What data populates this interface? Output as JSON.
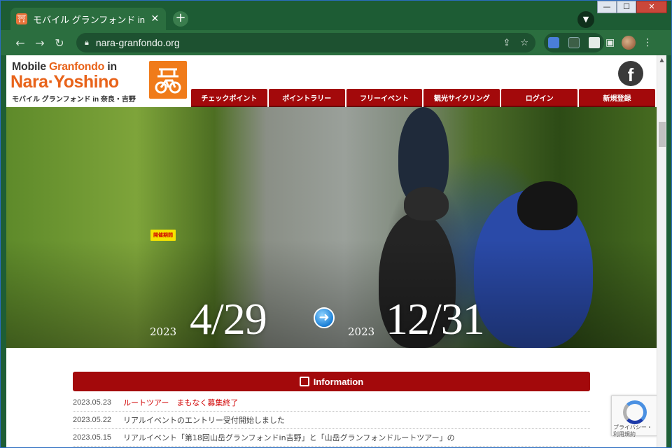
{
  "browser": {
    "tab_title": "モバイル グランフォンド in 奈良",
    "tab_close": "✕",
    "new_tab": "+",
    "url": "nara-granfondo.org"
  },
  "site": {
    "logo": {
      "line1_a": "Mobile ",
      "line1_b": "Granfondo",
      "line1_c": " in",
      "line2": "Nara·Yoshino",
      "line3": "モバイル グランフォンド in 奈良・吉野"
    },
    "facebook_glyph": "f",
    "nav": [
      "チェックポイント",
      "ポイントラリー",
      "フリーイベント",
      "観光サイクリング",
      "ログイン",
      "新規登録"
    ]
  },
  "hero": {
    "period_badge": "開催期間",
    "start_year": "2023",
    "start_date": "4/29",
    "end_year": "2023",
    "end_date": "12/31"
  },
  "info": {
    "heading": "Information",
    "items": [
      {
        "date": "2023.05.23",
        "text": "ルートツアー　まもなく募集終了",
        "highlight": true
      },
      {
        "date": "2023.05.22",
        "text": "リアルイベントのエントリー受付開始しました",
        "highlight": false
      },
      {
        "date": "2023.05.15",
        "text": "リアルイベント「第18回山岳グランフォンドin吉野」と「山岳グランフォンドルートツアー」の",
        "highlight": false
      }
    ]
  },
  "recaptcha": {
    "line1": "プライバシー・",
    "line2": "利用規約"
  }
}
